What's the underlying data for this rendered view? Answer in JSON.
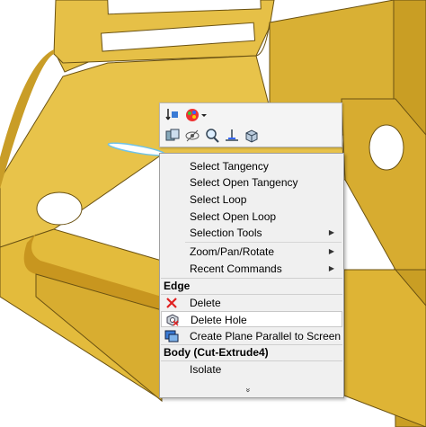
{
  "colors": {
    "part_face": "#e9c54b",
    "part_shadow": "#b98f1c",
    "part_edge": "#6b5212",
    "menu_bg": "#f0f0f0",
    "highlight_edge": "#6fc3e8"
  },
  "toolbar": {
    "icons": [
      "normal-to-view-icon",
      "appearance-icon",
      "dropdown-arrow-icon",
      "section-view-icon",
      "hide-show-icon",
      "zoom-to-selection-icon",
      "sketch-plane-icon",
      "view-orientation-icon"
    ]
  },
  "menu": {
    "selection_items": [
      "Select Tangency",
      "Select Open Tangency",
      "Select Loop",
      "Select Open Loop"
    ],
    "selection_tools": "Selection Tools",
    "zoom": "Zoom/Pan/Rotate",
    "recent": "Recent Commands",
    "edge_header": "Edge",
    "delete": "Delete",
    "delete_hole": "Delete Hole",
    "create_plane": "Create Plane Parallel to Screen",
    "body_header": "Body (Cut-Extrude4)",
    "isolate": "Isolate",
    "expand_glyph": "»"
  }
}
